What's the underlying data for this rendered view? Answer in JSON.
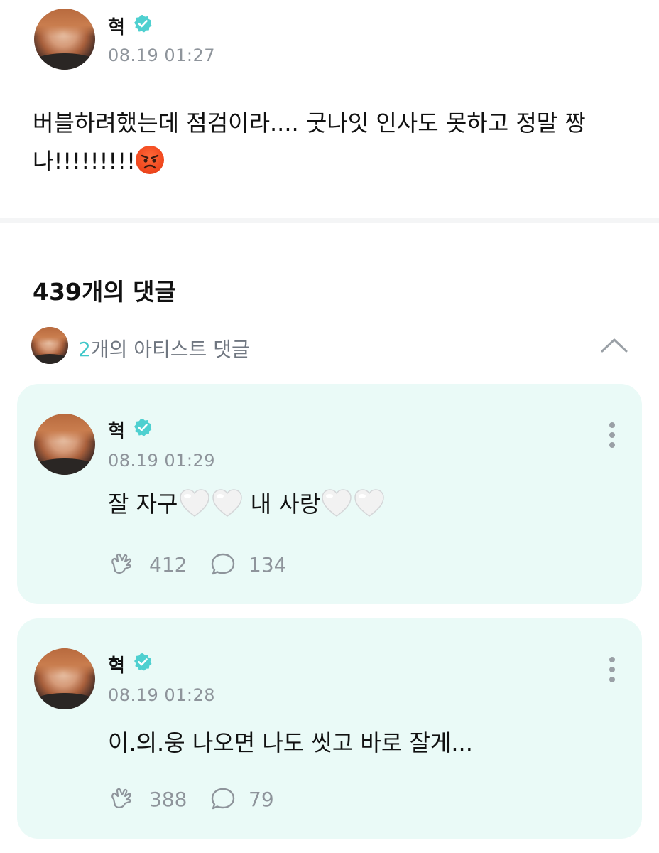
{
  "post": {
    "author": "혁",
    "timestamp": "08.19 01:27",
    "body_line1": "버블하려했는데 점검이라.... 굿나잇 인사도 못하고 정말 짱",
    "body_line2": "나!!!!!!!!!",
    "emoji": "angry-face"
  },
  "comments_header": {
    "title": "439개의 댓글",
    "artist_count": "2",
    "artist_label": "개의 아티스트 댓글"
  },
  "artist_comments": [
    {
      "author": "혁",
      "timestamp": "08.19 01:29",
      "text_a": "잘 자구",
      "text_b": "내 사랑",
      "hearts": "white-heart",
      "likes": "412",
      "replies": "134"
    },
    {
      "author": "혁",
      "timestamp": "08.19 01:28",
      "text": "이.의.웅 나오면 나도 씻고 바로 잘게...",
      "likes": "388",
      "replies": "79"
    }
  ],
  "colors": {
    "accent": "#3fc7c9",
    "card_bg": "#eafaf7",
    "meta_gray": "#8e949b"
  }
}
